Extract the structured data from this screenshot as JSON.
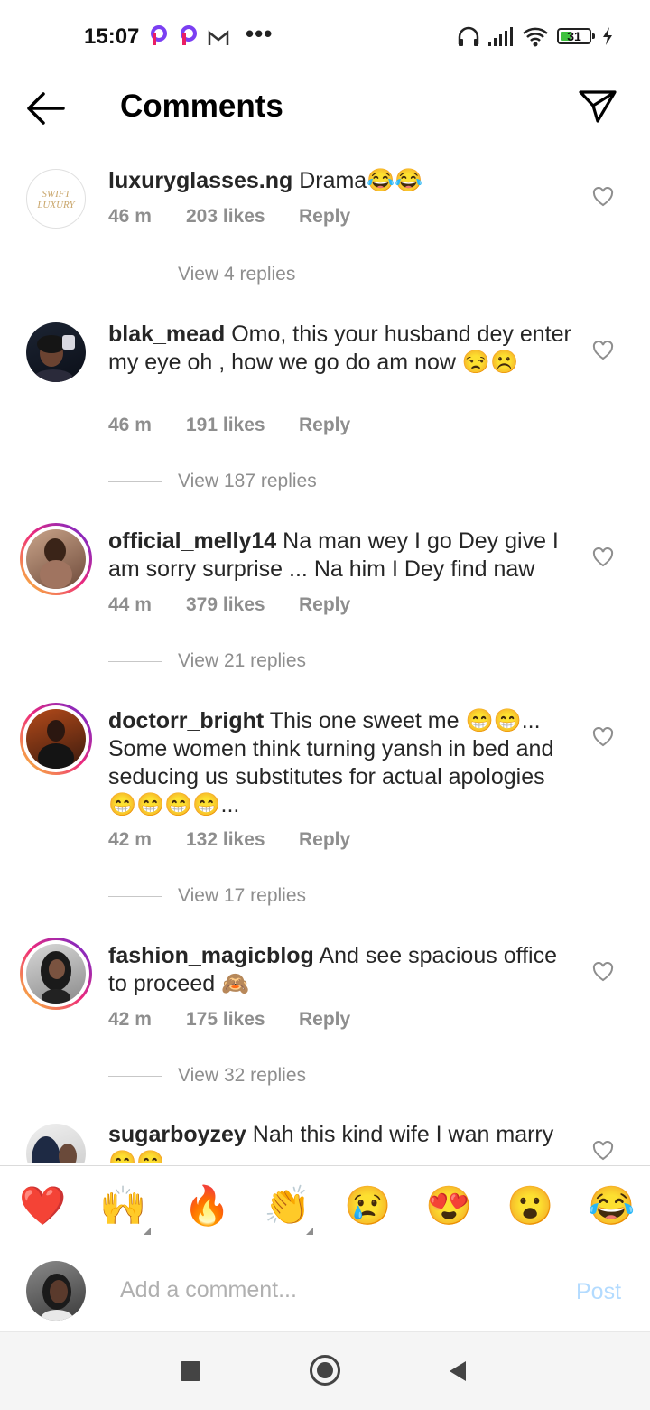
{
  "status_bar": {
    "time": "15:07",
    "notifications": [
      "p-app-icon",
      "p-app-icon",
      "gmail-icon"
    ],
    "more": "•••",
    "battery": "31"
  },
  "header": {
    "title": "Comments"
  },
  "comments": [
    {
      "username": "luxuryglasses.ng",
      "text": "Drama😂😂",
      "time": "46 m",
      "likes": "203 likes",
      "reply": "Reply",
      "view_replies": "View 4 replies"
    },
    {
      "username": "blak_mead",
      "text": "Omo, this your husband dey enter my eye oh , how we go do am now 😒☹️",
      "time": "46 m",
      "likes": "191 likes",
      "reply": "Reply",
      "view_replies": "View 187 replies"
    },
    {
      "username": "official_melly14",
      "text": "Na man wey I go Dey give I am sorry surprise ... Na him I Dey find naw",
      "time": "44 m",
      "likes": "379 likes",
      "reply": "Reply",
      "view_replies": "View 21 replies"
    },
    {
      "username": "doctorr_bright",
      "text": "This one sweet me 😁😁... Some women think turning yansh in bed and seducing us substitutes for actual apologies 😁😁😁😁...",
      "time": "42 m",
      "likes": "132 likes",
      "reply": "Reply",
      "view_replies": "View 17 replies"
    },
    {
      "username": "fashion_magicblog",
      "text": "And see spacious office to proceed 🙈",
      "time": "42 m",
      "likes": "175 likes",
      "reply": "Reply",
      "view_replies": "View 32 replies"
    },
    {
      "username": "sugarboyzey",
      "text": "Nah this kind wife I wan marry 😁😁"
    }
  ],
  "avatar_logo": {
    "line1": "SWIFT",
    "line2": "LUXURY"
  },
  "reactions": [
    "❤️",
    "🙌",
    "🔥",
    "👏",
    "😢",
    "😍",
    "😮",
    "😂"
  ],
  "composer": {
    "placeholder": "Add a comment...",
    "post_label": "Post"
  },
  "colors": {
    "post": "#b3dbff",
    "meta": "#8e8e8e",
    "heart_reaction": "#ed4956"
  }
}
